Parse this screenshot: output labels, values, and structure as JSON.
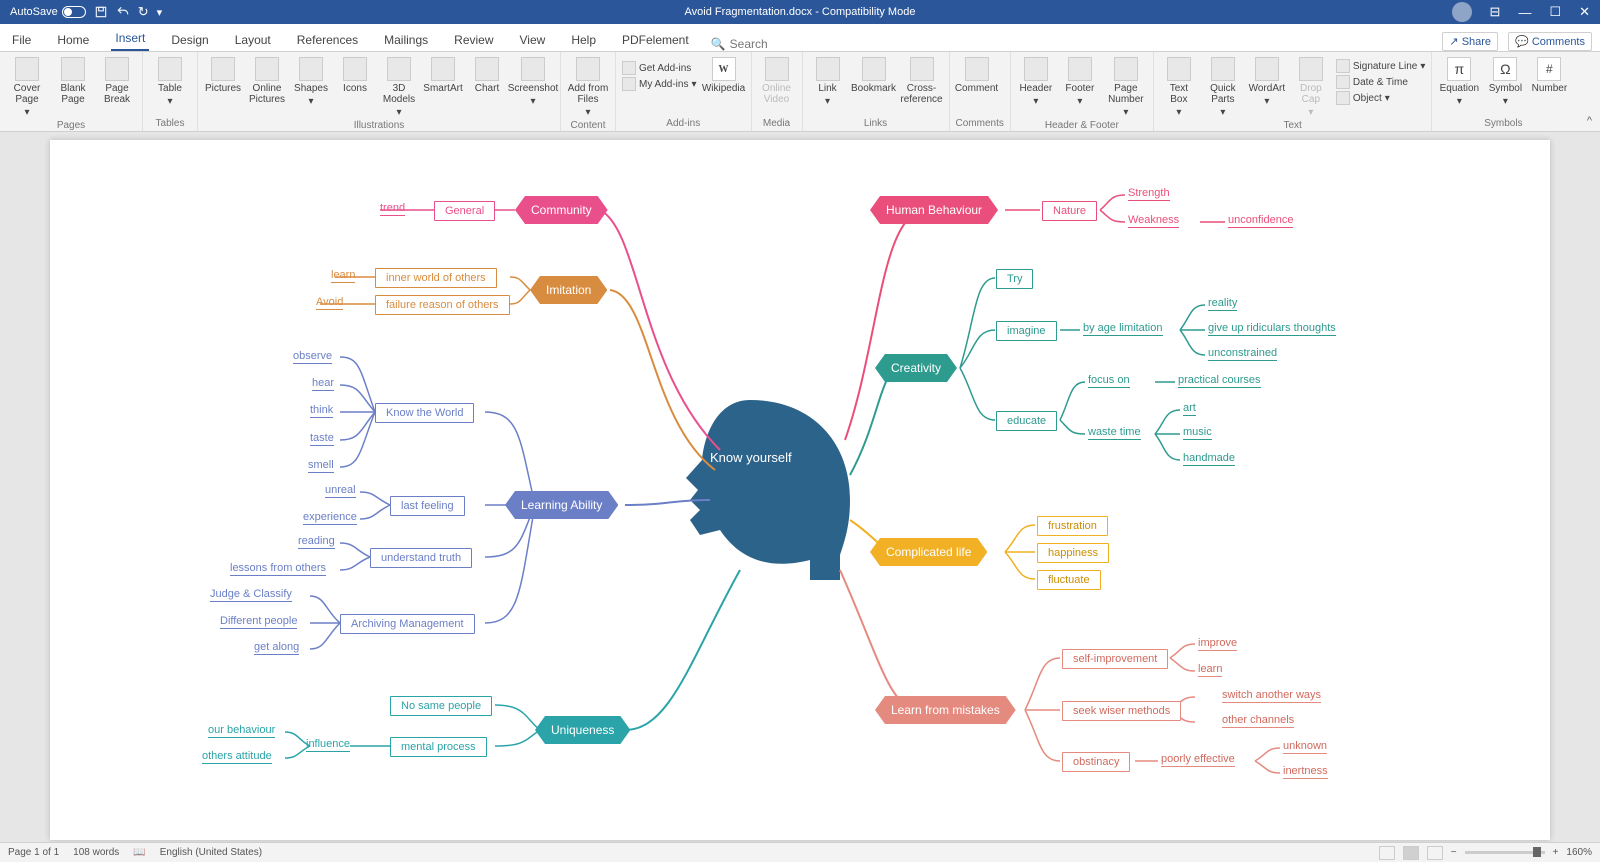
{
  "titlebar": {
    "autosave": "AutoSave",
    "title": "Avoid Fragmentation.docx - Compatibility Mode"
  },
  "menu": {
    "tabs": [
      "File",
      "Home",
      "Insert",
      "Design",
      "Layout",
      "References",
      "Mailings",
      "Review",
      "View",
      "Help",
      "PDFelement"
    ],
    "active": "Insert",
    "search": "Search",
    "share": "Share",
    "comments": "Comments"
  },
  "ribbon": {
    "groups": [
      {
        "label": "Pages",
        "items": [
          "Cover Page",
          "Blank Page",
          "Page Break"
        ]
      },
      {
        "label": "Tables",
        "items": [
          "Table"
        ]
      },
      {
        "label": "Illustrations",
        "items": [
          "Pictures",
          "Online Pictures",
          "Shapes",
          "Icons",
          "3D Models",
          "SmartArt",
          "Chart",
          "Screenshot"
        ]
      },
      {
        "label": "Content",
        "items": [
          "Add from Files"
        ]
      },
      {
        "label": "Add-ins",
        "col": [
          "Get Add-ins",
          "My Add-ins"
        ],
        "items": [
          "Wikipedia"
        ]
      },
      {
        "label": "Media",
        "items": [
          "Online Video"
        ]
      },
      {
        "label": "Links",
        "items": [
          "Link",
          "Bookmark",
          "Cross-reference"
        ]
      },
      {
        "label": "Comments",
        "items": [
          "Comment"
        ]
      },
      {
        "label": "Header & Footer",
        "items": [
          "Header",
          "Footer",
          "Page Number"
        ]
      },
      {
        "label": "Text",
        "items": [
          "Text Box",
          "Quick Parts",
          "WordArt",
          "Drop Cap"
        ],
        "col": [
          "Signature Line",
          "Date & Time",
          "Object"
        ]
      },
      {
        "label": "Symbols",
        "items": [
          "Equation",
          "Symbol",
          "Number"
        ]
      }
    ]
  },
  "mindmap": {
    "central": "Know yourself",
    "branches": [
      {
        "id": "community",
        "label": "Community",
        "color": "#e94f8a",
        "boxes": [
          {
            "t": "General"
          }
        ],
        "leaves": [
          {
            "t": "trend"
          }
        ]
      },
      {
        "id": "imitation",
        "label": "Imitation",
        "color": "#d88c3f",
        "boxes": [
          {
            "t": "inner world of others"
          },
          {
            "t": "failure reason of others"
          }
        ],
        "leaves": [
          {
            "t": "learn"
          },
          {
            "t": "Avoid"
          }
        ]
      },
      {
        "id": "learning",
        "label": "Learning Ability",
        "color": "#6b7fc7",
        "boxes": [
          {
            "t": "Know the World"
          },
          {
            "t": "last feeling"
          },
          {
            "t": "understand truth"
          },
          {
            "t": "Archiving Management"
          }
        ],
        "leaves": [
          {
            "t": "observe"
          },
          {
            "t": "hear"
          },
          {
            "t": "think"
          },
          {
            "t": "taste"
          },
          {
            "t": "smell"
          },
          {
            "t": "unreal"
          },
          {
            "t": "experience"
          },
          {
            "t": "reading"
          },
          {
            "t": "lessons from others"
          },
          {
            "t": "Judge & Classify"
          },
          {
            "t": "Different people"
          },
          {
            "t": "get along"
          }
        ]
      },
      {
        "id": "uniqueness",
        "label": "Uniqueness",
        "color": "#2aa4a8",
        "boxes": [
          {
            "t": "No same people"
          },
          {
            "t": "mental process"
          }
        ],
        "leaves": [
          {
            "t": "influence"
          },
          {
            "t": "our behaviour"
          },
          {
            "t": "others attitude"
          }
        ]
      },
      {
        "id": "humanbehaviour",
        "label": "Human Behaviour",
        "color": "#e94f7a",
        "boxes": [
          {
            "t": "Nature"
          }
        ],
        "leaves": [
          {
            "t": "Strength"
          },
          {
            "t": "Weakness"
          },
          {
            "t": "unconfidence"
          }
        ]
      },
      {
        "id": "creativity",
        "label": "Creativity",
        "color": "#2e9b8f",
        "boxes": [
          {
            "t": "Try"
          },
          {
            "t": "imagine"
          },
          {
            "t": "educate"
          }
        ],
        "leaves": [
          {
            "t": "by age limitation"
          },
          {
            "t": "reality"
          },
          {
            "t": "give up ridiculars thoughts"
          },
          {
            "t": "unconstrained"
          },
          {
            "t": "focus on"
          },
          {
            "t": "waste time"
          },
          {
            "t": "practical courses"
          },
          {
            "t": "art"
          },
          {
            "t": "music"
          },
          {
            "t": "handmade"
          }
        ]
      },
      {
        "id": "complicated",
        "label": "Complicated life",
        "color": "#f2b024",
        "boxes": [
          {
            "t": "frustration"
          },
          {
            "t": "happiness"
          },
          {
            "t": "fluctuate"
          }
        ]
      },
      {
        "id": "mistakes",
        "label": "Learn from mistakes",
        "color": "#e58a7f",
        "boxes": [
          {
            "t": "self-improvement"
          },
          {
            "t": "seek wiser methods"
          },
          {
            "t": "obstinacy"
          }
        ],
        "leaves": [
          {
            "t": "improve"
          },
          {
            "t": "learn"
          },
          {
            "t": "switch another ways"
          },
          {
            "t": "other channels"
          },
          {
            "t": "poorly effective"
          },
          {
            "t": "unknown"
          },
          {
            "t": "inertness"
          }
        ]
      }
    ]
  },
  "status": {
    "page": "Page 1 of 1",
    "words": "108 words",
    "lang": "English (United States)",
    "zoom": "160%"
  }
}
